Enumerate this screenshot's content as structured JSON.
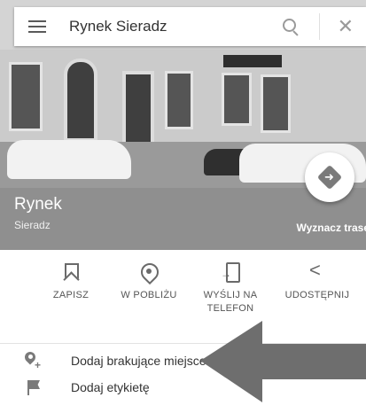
{
  "search": {
    "query": "Rynek Sieradz"
  },
  "place": {
    "name": "Rynek",
    "locality": "Sieradz",
    "route_label": "Wyznacz trasę"
  },
  "actions": [
    {
      "label": "ZAPISZ",
      "icon": "bookmark-icon"
    },
    {
      "label": "W POBLIŻU",
      "icon": "nearby-pin-icon"
    },
    {
      "label": "WYŚLIJ NA TELEFON",
      "icon": "send-to-phone-icon"
    },
    {
      "label": "UDOSTĘPNIJ",
      "icon": "share-icon"
    }
  ],
  "list": [
    {
      "label": "Dodaj brakujące miejsce",
      "icon": "add-place-icon"
    },
    {
      "label": "Dodaj etykietę",
      "icon": "flag-icon"
    }
  ],
  "colors": {
    "accent_gray": "#8f8f8f",
    "annotation_arrow": "#6e6e6e"
  }
}
